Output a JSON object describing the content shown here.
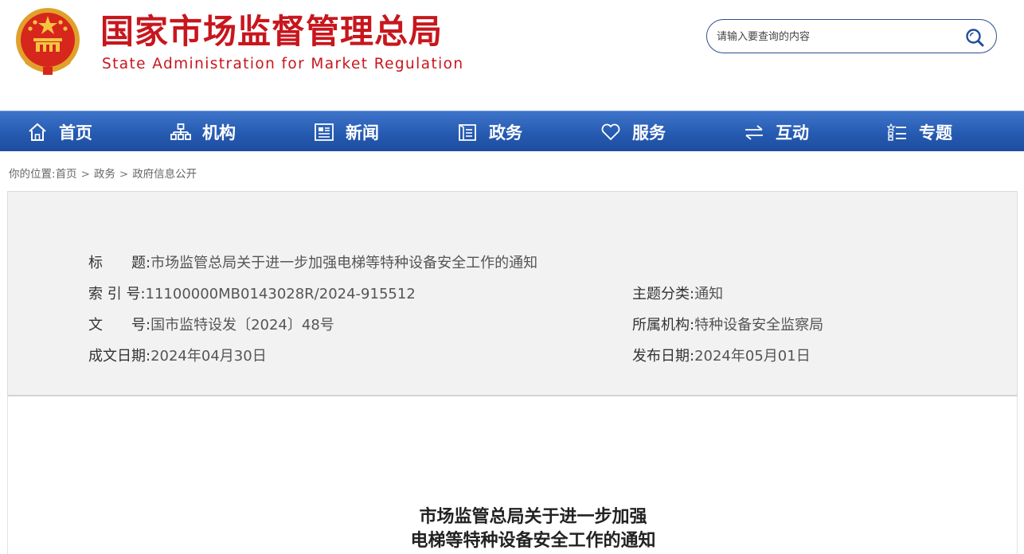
{
  "site": {
    "name_cn": "国家市场监督管理总局",
    "name_en": "State Administration for Market Regulation",
    "emblem_icon": "national-emblem",
    "brand_color": "#c8161d"
  },
  "search": {
    "placeholder": "请输入要查询的内容",
    "icon": "search-icon"
  },
  "nav": {
    "items": [
      {
        "label": "首页",
        "icon": "home-icon"
      },
      {
        "label": "机构",
        "icon": "org-chart-icon"
      },
      {
        "label": "新闻",
        "icon": "newspaper-icon"
      },
      {
        "label": "政务",
        "icon": "document-icon"
      },
      {
        "label": "服务",
        "icon": "heart-icon"
      },
      {
        "label": "互动",
        "icon": "exchange-arrows-icon"
      },
      {
        "label": "专题",
        "icon": "list-icon"
      }
    ],
    "color": "#265bb2"
  },
  "breadcrumb": {
    "prefix": "你的位置:",
    "items": [
      "首页",
      "政务",
      "政府信息公开"
    ],
    "separator": ">"
  },
  "info": {
    "title_label": "标　　题:",
    "title_value": "市场监管总局关于进一步加强电梯等特种设备安全工作的通知",
    "index_label": "索 引 号:",
    "index_value": "11100000MB0143028R/2024-915512",
    "topic_label": "主题分类:",
    "topic_value": "通知",
    "doc_no_label": "文　　号:",
    "doc_no_value": "国市监特设发〔2024〕48号",
    "org_label": "所属机构:",
    "org_value": "特种设备安全监察局",
    "date_label": "成文日期:",
    "date_value": "2024年04月30日",
    "pub_label": "发布日期:",
    "pub_value": "2024年05月01日"
  },
  "document": {
    "title_line1": "市场监管总局关于进一步加强",
    "title_line2": "电梯等特种设备安全工作的通知"
  }
}
